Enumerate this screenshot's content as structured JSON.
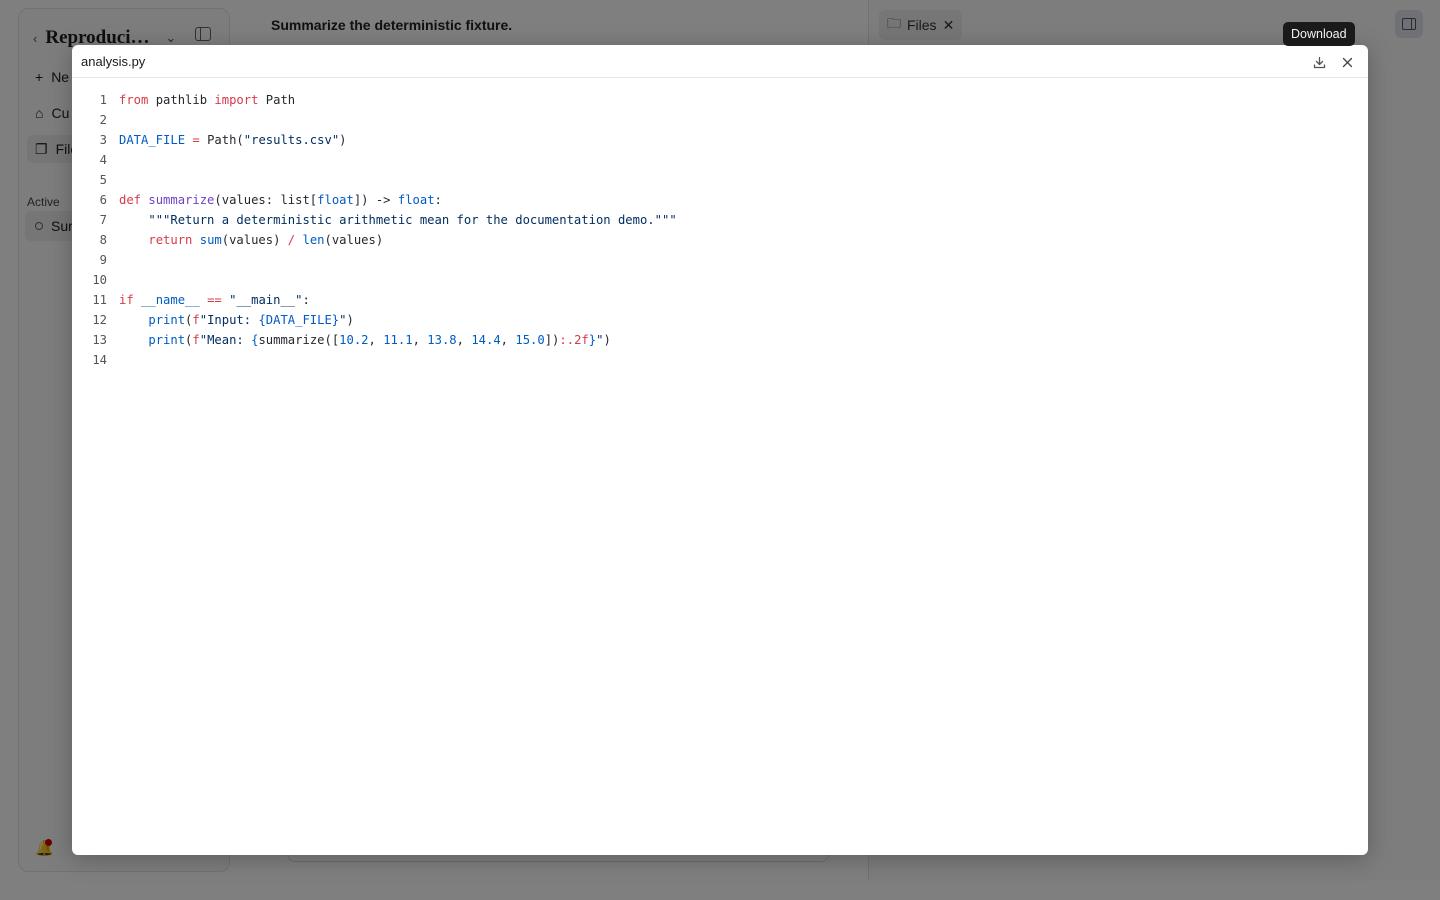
{
  "background": {
    "sidebar": {
      "title": "Reproducibl...",
      "items": [
        {
          "label": "Ne",
          "icon": "plus-icon"
        },
        {
          "label": "Cu",
          "icon": "box-icon"
        },
        {
          "label": "File",
          "icon": "files-icon"
        }
      ],
      "section_label": "Active",
      "conversation_label": "Sur"
    },
    "chat_title": "Summarize the deterministic fixture.",
    "right_panel": {
      "tab_label": "Files"
    }
  },
  "tooltip": {
    "text": "Download"
  },
  "modal": {
    "title": "analysis.py",
    "download_icon": "download-icon",
    "close_icon": "close-icon",
    "code_lines": [
      {
        "n": "1",
        "tokens": [
          [
            "kw",
            "from"
          ],
          [
            "",
            "  pathlib "
          ],
          [
            "kw",
            "import"
          ],
          [
            "",
            " Path"
          ]
        ]
      },
      {
        "n": "2",
        "tokens": []
      },
      {
        "n": "3",
        "tokens": [
          [
            "bl",
            "DATA_FILE"
          ],
          [
            "",
            " "
          ],
          [
            "kw",
            "="
          ],
          [
            "",
            " Path("
          ],
          [
            "st",
            "\"results.csv\""
          ],
          [
            "",
            ")"
          ]
        ]
      },
      {
        "n": "4",
        "tokens": []
      },
      {
        "n": "5",
        "tokens": []
      },
      {
        "n": "6",
        "tokens": [
          [
            "kw",
            "def"
          ],
          [
            "",
            " "
          ],
          [
            "fn",
            "summarize"
          ],
          [
            "",
            "(values: list["
          ],
          [
            "bl",
            "float"
          ],
          [
            "",
            "]) -> "
          ],
          [
            "bl",
            "float"
          ],
          [
            "",
            ":"
          ]
        ]
      },
      {
        "n": "7",
        "tokens": [
          [
            "",
            "    "
          ],
          [
            "st",
            "\"\"\"Return a deterministic arithmetic mean for the documentation demo.\"\"\""
          ]
        ]
      },
      {
        "n": "8",
        "tokens": [
          [
            "",
            "    "
          ],
          [
            "kw",
            "return"
          ],
          [
            "",
            " "
          ],
          [
            "bl",
            "sum"
          ],
          [
            "",
            "(values) "
          ],
          [
            "kw",
            "/"
          ],
          [
            "",
            " "
          ],
          [
            "bl",
            "len"
          ],
          [
            "",
            "(values)"
          ]
        ]
      },
      {
        "n": "9",
        "tokens": []
      },
      {
        "n": "10",
        "tokens": []
      },
      {
        "n": "11",
        "tokens": [
          [
            "kw",
            "if"
          ],
          [
            "",
            " "
          ],
          [
            "bl",
            "__name__"
          ],
          [
            "",
            " "
          ],
          [
            "kw",
            "=="
          ],
          [
            "",
            " "
          ],
          [
            "st",
            "\"__main__\""
          ],
          [
            "",
            ":"
          ]
        ]
      },
      {
        "n": "12",
        "tokens": [
          [
            "",
            "    "
          ],
          [
            "bl",
            "print"
          ],
          [
            "",
            "("
          ],
          [
            "kw",
            "f"
          ],
          [
            "st",
            "\"Input: "
          ],
          [
            "bl",
            "{DATA_FILE}"
          ],
          [
            "st",
            "\""
          ],
          [
            "",
            ")"
          ]
        ]
      },
      {
        "n": "13",
        "tokens": [
          [
            "",
            "    "
          ],
          [
            "bl",
            "print"
          ],
          [
            "",
            "("
          ],
          [
            "kw",
            "f"
          ],
          [
            "st",
            "\"Mean: "
          ],
          [
            "bl",
            "{"
          ],
          [
            "",
            "summarize(["
          ],
          [
            "nm",
            "10.2"
          ],
          [
            "",
            ", "
          ],
          [
            "nm",
            "11.1"
          ],
          [
            "",
            ", "
          ],
          [
            "nm",
            "13.8"
          ],
          [
            "",
            ", "
          ],
          [
            "nm",
            "14.4"
          ],
          [
            "",
            ", "
          ],
          [
            "nm",
            "15.0"
          ],
          [
            "",
            "])"
          ],
          [
            "kw",
            ":.2f"
          ],
          [
            "bl",
            "}"
          ],
          [
            "st",
            "\""
          ],
          [
            "",
            ")"
          ]
        ]
      },
      {
        "n": "14",
        "tokens": []
      }
    ]
  }
}
